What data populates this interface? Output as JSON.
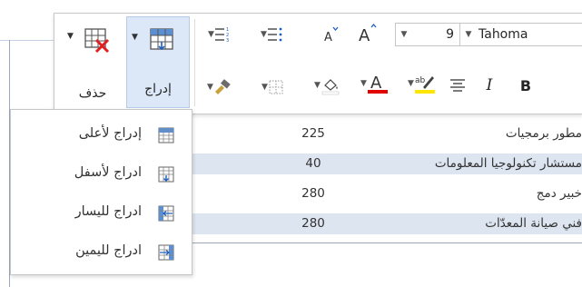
{
  "table": {
    "rows": [
      {
        "job": "مطور برمجيات",
        "value": "225"
      },
      {
        "job": "مستشار تكنولوجيا المعلومات",
        "value": "40"
      },
      {
        "job": "خبير دمج",
        "value": "280"
      },
      {
        "job": "فني صيانة المعدّات",
        "value": "280"
      }
    ]
  },
  "toolbar": {
    "insert_label": "إدراج",
    "delete_label": "حذف",
    "font_name": "Tahoma",
    "font_size": "9",
    "bold_label": "B",
    "italic_label": "I",
    "font_color": "#e00000",
    "highlight_color": "#ffe600"
  },
  "insert_menu": {
    "items": [
      {
        "label": "إدراج لأعلى",
        "icon": "insert-above-icon"
      },
      {
        "label": "ادراج لأسفل",
        "icon": "insert-below-icon"
      },
      {
        "label": "ادراج لليسار",
        "icon": "insert-left-icon"
      },
      {
        "label": "ادراج لليمين",
        "icon": "insert-right-icon"
      }
    ]
  }
}
